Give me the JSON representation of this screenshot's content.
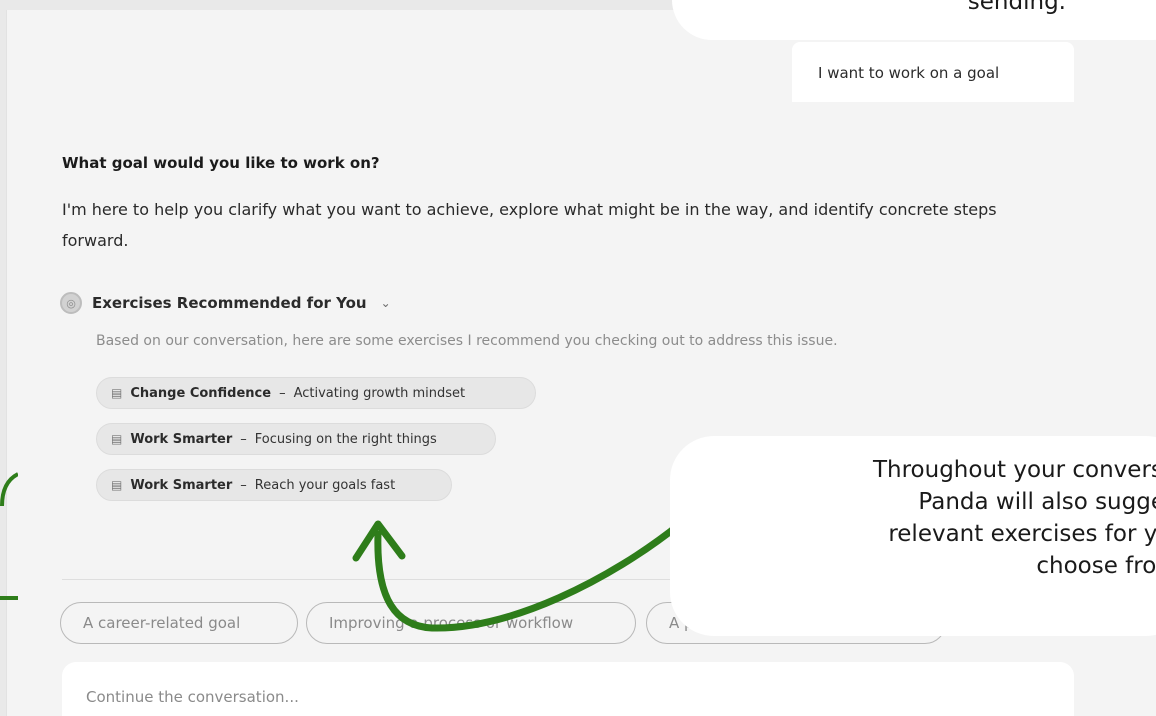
{
  "callouts": {
    "top_text": "sending.",
    "bottom_lines": [
      "Throughout your conversat",
      "Panda will also suggest",
      "relevant exercises for you",
      "choose from."
    ]
  },
  "user_message": "I want to work on a goal",
  "assistant": {
    "question": "What goal would you like to work on?",
    "body": "I'm here to help you clarify what you want to achieve, explore what might be in the way, and identify concrete steps forward."
  },
  "recommendations": {
    "icon": "compass-icon",
    "title": "Exercises Recommended for You",
    "description": "Based on our conversation, here are some exercises I recommend you checking out to address this issue.",
    "items": [
      {
        "category": "Change Confidence",
        "separator": "–",
        "name": "Activating growth mindset"
      },
      {
        "category": "Work Smarter",
        "separator": "–",
        "name": "Focusing on the right things"
      },
      {
        "category": "Work Smarter",
        "separator": "–",
        "name": "Reach your goals fast"
      }
    ]
  },
  "suggestions": [
    "A career-related goal",
    "Improving a process or workflow",
    "A pe"
  ],
  "composer": {
    "placeholder": "Continue the conversation..."
  },
  "colors": {
    "annotation_arrow": "#2e7d1a",
    "panel_bg": "#f4f4f4"
  }
}
